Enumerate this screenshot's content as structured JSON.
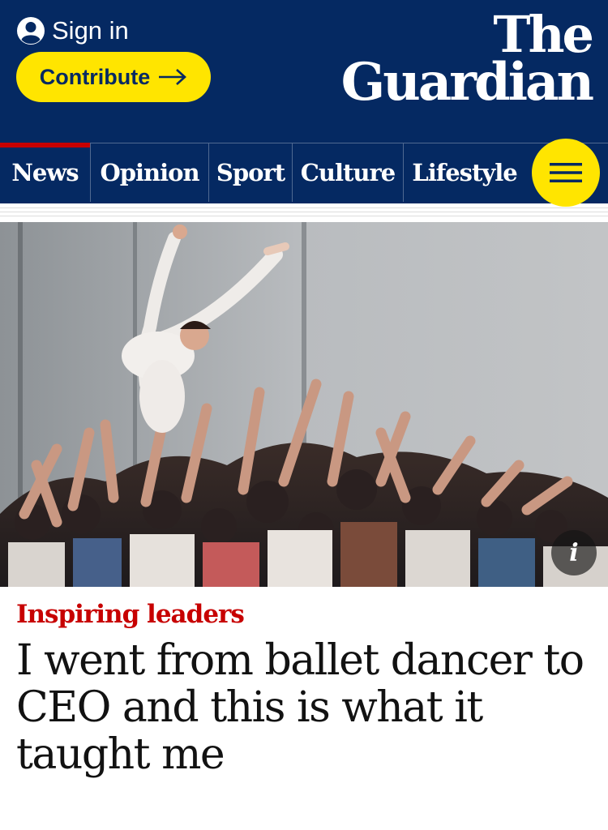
{
  "header": {
    "signin_label": "Sign in",
    "contribute_label": "Contribute",
    "logo_line1": "The",
    "logo_line2": "Guardian",
    "brand_color": "#052962",
    "accent_color": "#ffe500"
  },
  "nav": {
    "items": [
      {
        "label": "News"
      },
      {
        "label": "Opinion"
      },
      {
        "label": "Sport"
      },
      {
        "label": "Culture"
      },
      {
        "label": "Lifestyle"
      }
    ],
    "active_color": "#c70000",
    "menu_icon": "hamburger-icon"
  },
  "article": {
    "kicker": "Inspiring leaders",
    "headline": "I went from ballet dancer to CEO and this is what it taught me",
    "info_label": "i",
    "kicker_color": "#c70000"
  }
}
